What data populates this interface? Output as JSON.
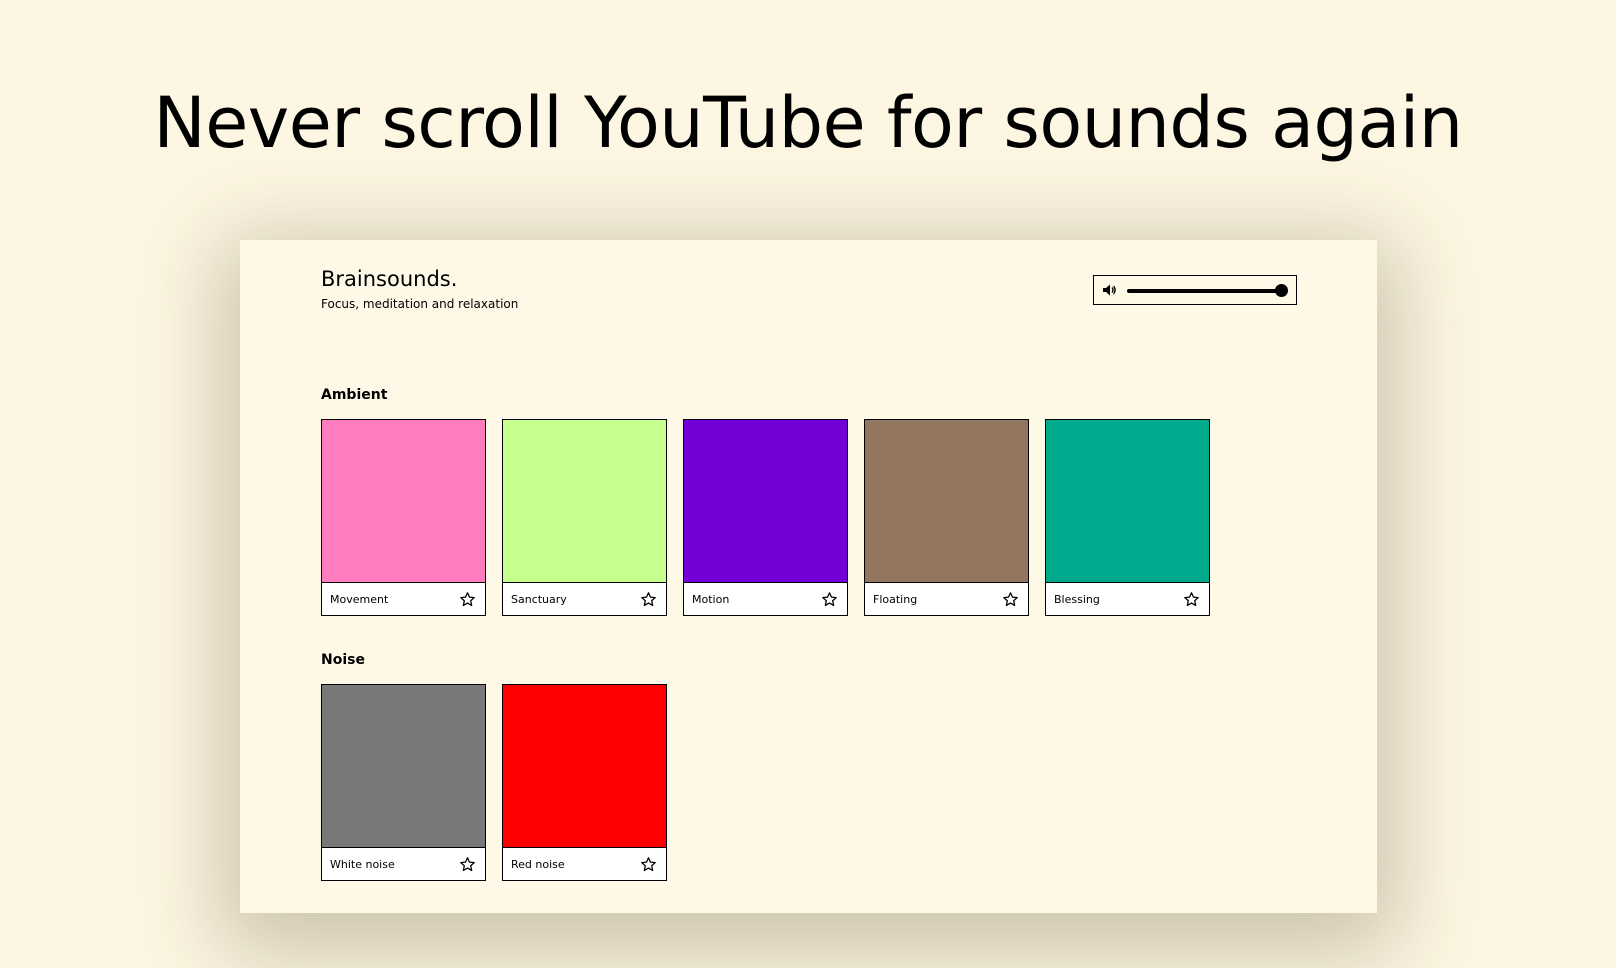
{
  "headline": "Never scroll YouTube for sounds again",
  "app": {
    "title": "Brainsounds.",
    "subtitle": "Focus, meditation and relaxation",
    "volume": {
      "icon": "speaker-icon",
      "level": 1.0
    }
  },
  "sections": [
    {
      "title": "Ambient",
      "sounds": [
        {
          "label": "Movement",
          "color": "#ff7dbe",
          "favorite_icon": "star-icon"
        },
        {
          "label": "Sanctuary",
          "color": "#c6ff8e",
          "favorite_icon": "star-icon"
        },
        {
          "label": "Motion",
          "color": "#7400d8",
          "favorite_icon": "star-icon"
        },
        {
          "label": "Floating",
          "color": "#92765f",
          "favorite_icon": "star-icon"
        },
        {
          "label": "Blessing",
          "color": "#00aa8c",
          "favorite_icon": "star-icon"
        }
      ]
    },
    {
      "title": "Noise",
      "sounds": [
        {
          "label": "White noise",
          "color": "#787878",
          "favorite_icon": "star-icon"
        },
        {
          "label": "Red noise",
          "color": "#ff0000",
          "favorite_icon": "star-icon"
        }
      ]
    }
  ],
  "colors": {
    "page_background": "#fdf6e2",
    "window_background": "#fef8e6",
    "border": "#000000"
  }
}
